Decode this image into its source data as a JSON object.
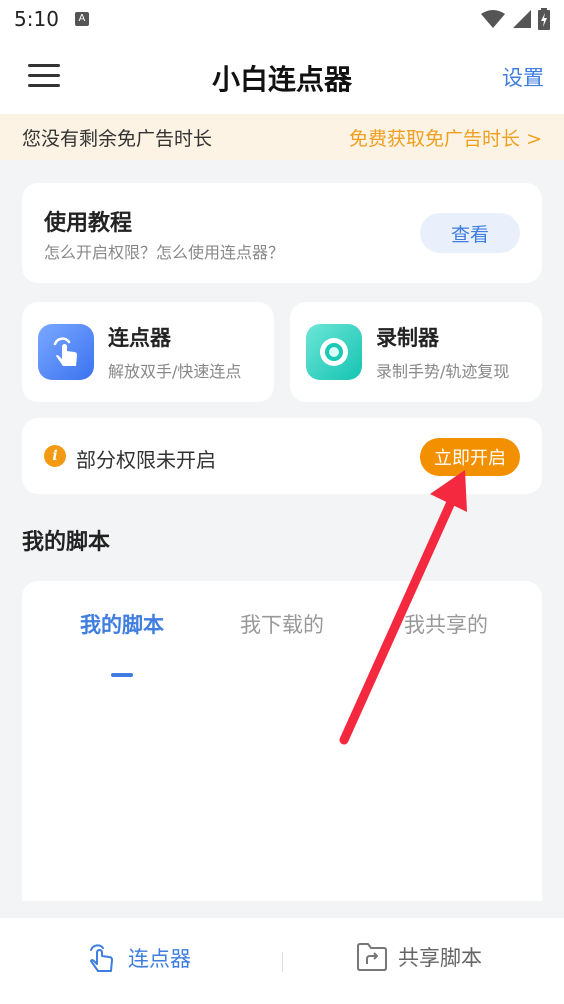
{
  "status_bar": {
    "time": "5:10",
    "a_glyph": "A"
  },
  "header": {
    "title": "小白连点器",
    "settings_label": "设置"
  },
  "ad_banner": {
    "text": "您没有剩余免广告时长",
    "link": "免费获取免广告时长 >"
  },
  "tutorial": {
    "title": "使用教程",
    "subtitle": "怎么开启权限？怎么使用连点器？",
    "button": "查看"
  },
  "tools": [
    {
      "title": "连点器",
      "subtitle": "解放双手/快速连点",
      "icon": "hand-tap-icon"
    },
    {
      "title": "录制器",
      "subtitle": "录制手势/轨迹复现",
      "icon": "record-icon"
    }
  ],
  "permission": {
    "info_glyph": "i",
    "text": "部分权限未开启",
    "button": "立即开启"
  },
  "scripts_section": {
    "title": "我的脚本",
    "tabs": [
      "我的脚本",
      "我下载的",
      "我共享的"
    ],
    "active_tab": 0
  },
  "bottom_nav": [
    {
      "label": "连点器",
      "icon": "hand-tap-icon",
      "active": true
    },
    {
      "label": "共享脚本",
      "icon": "shared-folder-icon",
      "active": false
    }
  ],
  "colors": {
    "accent": "#3f7de0",
    "orange": "#f39000",
    "annotation_arrow": "#f4283e",
    "ad_background": "#fdf3e4"
  }
}
